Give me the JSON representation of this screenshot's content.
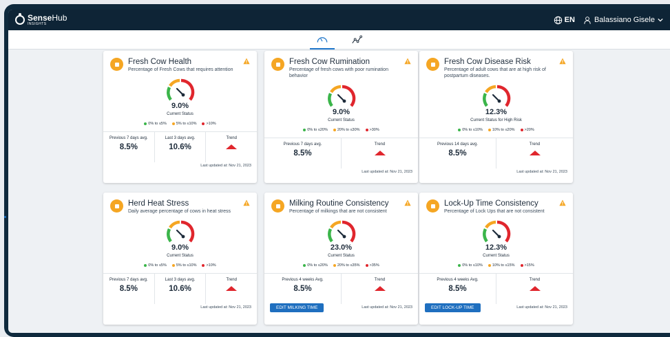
{
  "header": {
    "logo_main": "Sense",
    "logo_accent": "Hub",
    "logo_sub": "INSIGHTS",
    "language": "EN",
    "user_name": "Balassiano Gisele"
  },
  "subnav": {
    "tabs": [
      {
        "icon": "speedometer-icon",
        "active": true
      },
      {
        "icon": "trend-line-icon",
        "active": false
      }
    ]
  },
  "cards": [
    {
      "title": "Fresh Cow Health",
      "subtitle": "Percentage of Fresh Cows that requires attention",
      "icon": "first-aid-icon",
      "value": "9.0%",
      "status_label": "Current Status",
      "legend": [
        "0% to ≤5%",
        "5% to ≤10%",
        ">10%"
      ],
      "stats": [
        {
          "label": "Previous 7 days avg.",
          "value": "8.5%"
        },
        {
          "label": "Last 3 days avg.",
          "value": "10.6%"
        },
        {
          "label": "Trend",
          "value": ""
        }
      ],
      "updated": "Last updated at: Nov 21, 2023",
      "button": ""
    },
    {
      "title": "Fresh Cow Rumination",
      "subtitle": "Percentage of fresh cows with poor rumination behavior",
      "icon": "rumination-icon",
      "value": "9.0%",
      "status_label": "Current Status",
      "legend": [
        "0% to ≤20%",
        "20% to ≤30%",
        ">30%"
      ],
      "stats": [
        {
          "label": "Previous 7 days avg.",
          "value": "8.5%"
        },
        {
          "label": "Trend",
          "value": ""
        }
      ],
      "updated": "Last updated at: Nov 21, 2023",
      "button": ""
    },
    {
      "title": "Fresh Cow Disease Risk",
      "subtitle": "Percentage of adult cows that are at high risk of postpartum diseases.",
      "icon": "medical-bag-icon",
      "value": "12.3%",
      "status_label": "Current Status for High Risk",
      "legend": [
        "0% to ≤10%",
        "10% to ≤20%",
        ">20%"
      ],
      "stats": [
        {
          "label": "Previous 14 days avg.",
          "value": "8.5%"
        },
        {
          "label": "Trend",
          "value": ""
        }
      ],
      "updated": "Last updated at: Nov 21, 2023",
      "button": ""
    },
    {
      "title": "Herd Heat Stress",
      "subtitle": "Daily average percentage of cows in heat stress",
      "icon": "thermometer-icon",
      "value": "9.0%",
      "status_label": "Current Status",
      "legend": [
        "0% to ≤5%",
        "5% to ≤10%",
        ">10%"
      ],
      "stats": [
        {
          "label": "Previous 7 days avg.",
          "value": "8.5%"
        },
        {
          "label": "Last 3 days avg.",
          "value": "10.6%"
        },
        {
          "label": "Trend",
          "value": ""
        }
      ],
      "updated": "Last updated at: Nov 21, 2023",
      "button": ""
    },
    {
      "title": "Milking Routine Consistency",
      "subtitle": "Percentage of milkings that are not consistent",
      "icon": "milk-bottle-icon",
      "value": "23.0%",
      "status_label": "Current Status",
      "legend": [
        "0% to ≤20%",
        "20% to ≤35%",
        ">35%"
      ],
      "stats": [
        {
          "label": "Previous 4 weeks Avg.",
          "value": "8.5%"
        },
        {
          "label": "Trend",
          "value": ""
        }
      ],
      "updated": "Last updated at: Nov 21, 2023",
      "button": "EDIT MILKING TIME"
    },
    {
      "title": "Lock-Up Time Consistency",
      "subtitle": "Percentage of Lock Ups that are not consistent",
      "icon": "lockup-gate-icon",
      "value": "12.3%",
      "status_label": "Current Status",
      "legend": [
        "0% to ≤10%",
        "10% to ≤15%",
        ">15%"
      ],
      "stats": [
        {
          "label": "Previous 4 weeks Avg.",
          "value": "8.5%"
        },
        {
          "label": "Trend",
          "value": ""
        }
      ],
      "updated": "Last updated at: Nov 21, 2023",
      "button": "EDIT LOCK-UP TIME"
    }
  ],
  "colors": {
    "good": "#3bb54a",
    "warning": "#f5a623",
    "bad": "#e0262d",
    "accent": "#1f6fbf",
    "topbar": "#0e2436"
  }
}
